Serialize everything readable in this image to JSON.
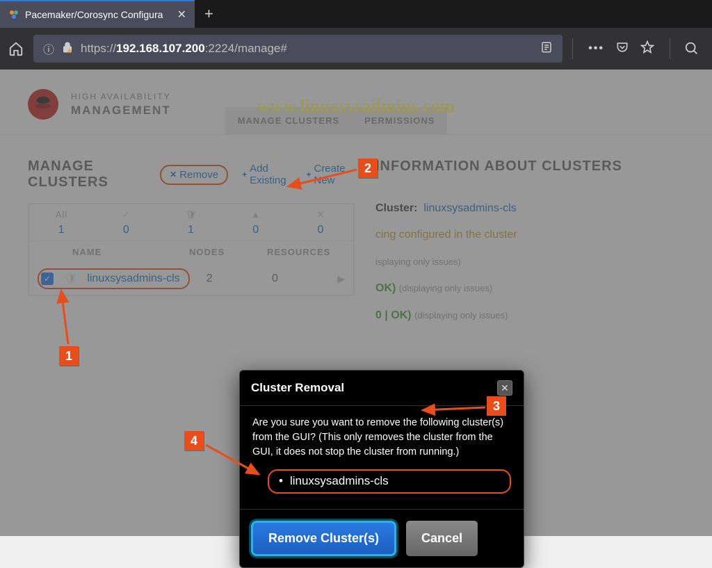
{
  "browser": {
    "tab_title": "Pacemaker/Corosync Configura",
    "url_prefix": "https://",
    "url_host": "192.168.107.200",
    "url_port": ":2224",
    "url_path": "/manage#"
  },
  "watermark": "www.linuxsysadmins.com",
  "brand": {
    "line1": "HIGH AVAILABILITY",
    "line2": "MANAGEMENT"
  },
  "nav": {
    "tab1": "MANAGE CLUSTERS",
    "tab2": "PERMISSIONS"
  },
  "section_title": "MANAGE CLUSTERS",
  "actions": {
    "remove": "Remove",
    "add": "Add Existing",
    "create": "Create New"
  },
  "table": {
    "head": {
      "all": "All",
      "counts": [
        "1",
        "0",
        "1",
        "0",
        "0"
      ]
    },
    "cols": {
      "name": "NAME",
      "nodes": "NODES",
      "resources": "RESOURCES"
    },
    "row": {
      "name": "linuxsysadmins-cls",
      "nodes": "2",
      "resources": "0"
    }
  },
  "info": {
    "title": "INFORMATION ABOUT CLUSTERS",
    "cluster_label": "Cluster:",
    "cluster_name": "linuxsysadmins-cls",
    "fencing_warn": "cing configured in the cluster",
    "nodes_small": "isplaying only issues)",
    "res_ok": "OK)",
    "res_small": "(displaying only issues)",
    "fence_ok": "0 | OK)",
    "fence_small": "(displaying only issues)"
  },
  "modal": {
    "title": "Cluster Removal",
    "body": "Are you sure you want to remove the following cluster(s) from the GUI? (This only removes the cluster from the GUI, it does not stop the cluster from running.)",
    "item": "linuxsysadmins-cls",
    "btn_remove": "Remove Cluster(s)",
    "btn_cancel": "Cancel"
  },
  "markers": {
    "m1": "1",
    "m2": "2",
    "m3": "3",
    "m4": "4"
  }
}
